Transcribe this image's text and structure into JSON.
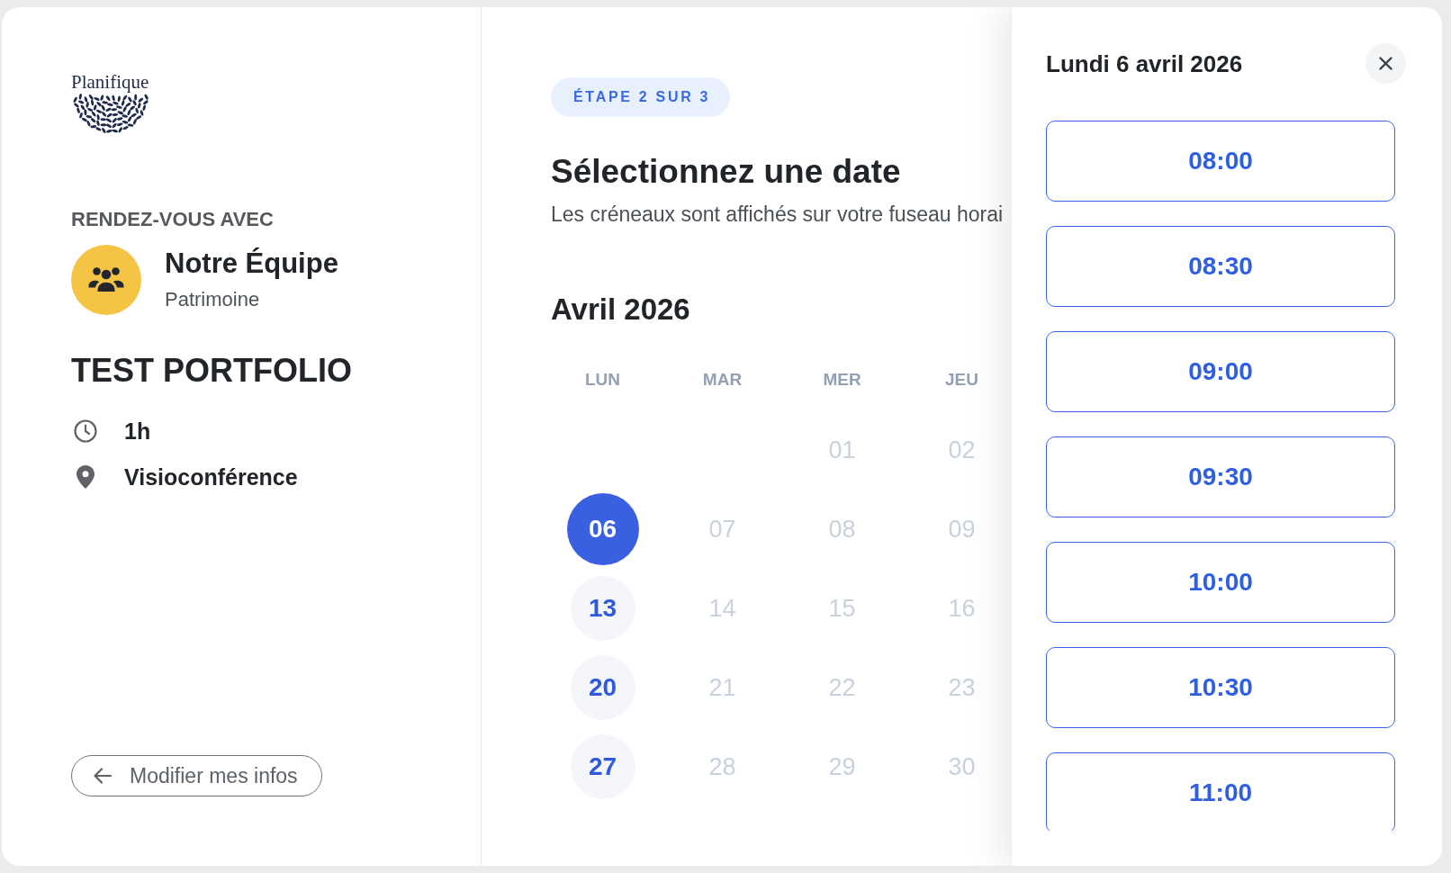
{
  "logo": {
    "text": "Planifique"
  },
  "host": {
    "label": "RENDEZ-VOUS AVEC",
    "name": "Notre Équipe",
    "team": "Patrimoine"
  },
  "event": {
    "title": "TEST PORTFOLIO",
    "details": [
      {
        "kind": "duration",
        "text": "1h"
      },
      {
        "kind": "location",
        "text": "Visioconférence"
      }
    ]
  },
  "back_button": {
    "label": "Modifier mes infos"
  },
  "step": {
    "label": "ÉTAPE 2 SUR 3"
  },
  "heading": "Sélectionnez une date",
  "subtitle": "Les créneaux sont affichés sur votre fuseau horai",
  "calendar": {
    "month": "Avril 2026",
    "weekdays": [
      "LUN",
      "MAR",
      "MER",
      "JEU"
    ],
    "weeks": [
      [
        {
          "label": "01",
          "available": false,
          "selected": false
        },
        {
          "label": "02",
          "available": false,
          "selected": false
        }
      ],
      [
        {
          "label": "06",
          "available": true,
          "selected": true
        },
        {
          "label": "07",
          "available": false,
          "selected": false
        },
        {
          "label": "08",
          "available": false,
          "selected": false
        },
        {
          "label": "09",
          "available": false,
          "selected": false
        }
      ],
      [
        {
          "label": "13",
          "available": true,
          "selected": false
        },
        {
          "label": "14",
          "available": false,
          "selected": false
        },
        {
          "label": "15",
          "available": false,
          "selected": false
        },
        {
          "label": "16",
          "available": false,
          "selected": false
        }
      ],
      [
        {
          "label": "20",
          "available": true,
          "selected": false
        },
        {
          "label": "21",
          "available": false,
          "selected": false
        },
        {
          "label": "22",
          "available": false,
          "selected": false
        },
        {
          "label": "23",
          "available": false,
          "selected": false
        }
      ],
      [
        {
          "label": "27",
          "available": true,
          "selected": false
        },
        {
          "label": "28",
          "available": false,
          "selected": false
        },
        {
          "label": "29",
          "available": false,
          "selected": false
        },
        {
          "label": "30",
          "available": false,
          "selected": false
        }
      ]
    ]
  },
  "slots_panel": {
    "title": "Lundi 6 avril 2026",
    "slots": [
      {
        "label": "08:00",
        "selected": false
      },
      {
        "label": "08:30",
        "selected": false
      },
      {
        "label": "09:00",
        "selected": false
      },
      {
        "label": "09:30",
        "selected": false
      },
      {
        "label": "10:00",
        "selected": false
      },
      {
        "label": "10:30",
        "selected": false
      },
      {
        "label": "11:00",
        "selected": false
      }
    ]
  }
}
